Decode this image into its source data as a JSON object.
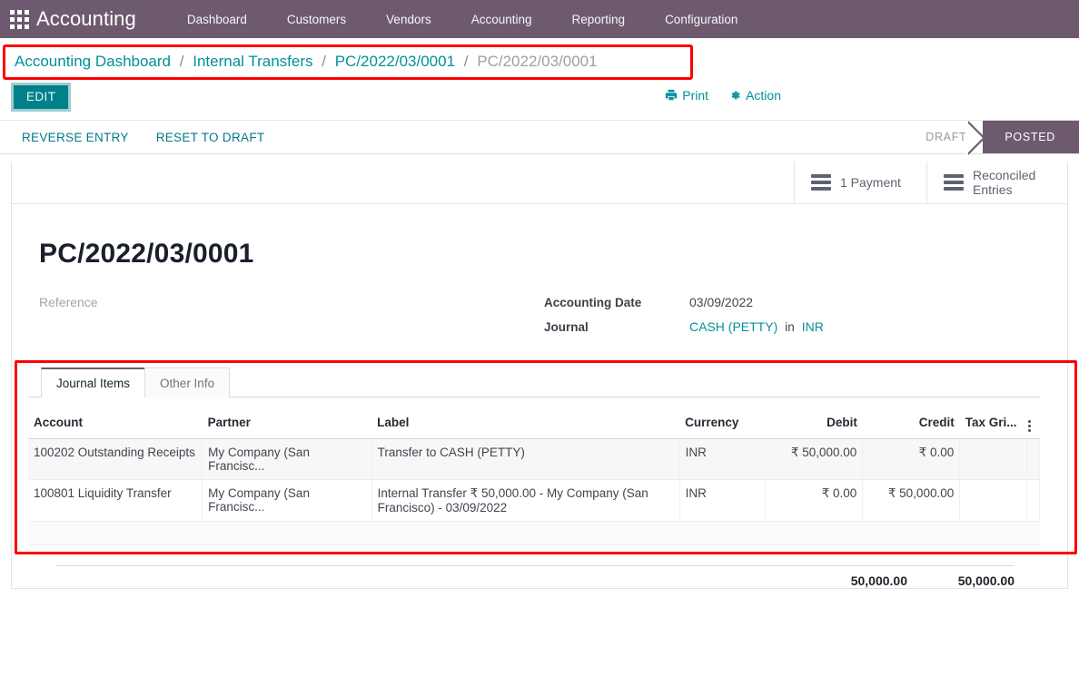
{
  "navbar": {
    "apps_icon": "apps-grid-icon",
    "brand": "Accounting",
    "menu": [
      {
        "label": "Dashboard"
      },
      {
        "label": "Customers"
      },
      {
        "label": "Vendors"
      },
      {
        "label": "Accounting"
      },
      {
        "label": "Reporting"
      },
      {
        "label": "Configuration"
      }
    ]
  },
  "breadcrumb": {
    "items": [
      {
        "label": "Accounting Dashboard",
        "type": "link"
      },
      {
        "label": "Internal Transfers",
        "type": "link"
      },
      {
        "label": "PC/2022/03/0001",
        "type": "link"
      },
      {
        "label": "PC/2022/03/0001",
        "type": "current"
      }
    ],
    "separator": "/"
  },
  "control_panel": {
    "edit_label": "EDIT",
    "print_label": "Print",
    "print_icon": "printer-icon",
    "action_label": "Action",
    "action_icon": "gear-icon"
  },
  "statusbar": {
    "buttons": [
      {
        "label": "REVERSE ENTRY"
      },
      {
        "label": "RESET TO DRAFT"
      }
    ],
    "states": [
      {
        "label": "DRAFT",
        "active": false
      },
      {
        "label": "POSTED",
        "active": true
      }
    ],
    "active_color": "#6d5a6e"
  },
  "smart_buttons": [
    {
      "label": "1 Payment",
      "icon": "bars-icon"
    },
    {
      "label": "Reconciled Entries",
      "icon": "bars-icon"
    }
  ],
  "record": {
    "title": "PC/2022/03/0001",
    "reference_placeholder": "Reference",
    "accounting_date_label": "Accounting Date",
    "accounting_date_value": "03/09/2022",
    "journal_label": "Journal",
    "journal_value": "CASH (PETTY)",
    "journal_in": "in",
    "journal_currency": "INR"
  },
  "notebook": {
    "tabs": [
      {
        "label": "Journal Items",
        "active": true
      },
      {
        "label": "Other Info",
        "active": false
      }
    ]
  },
  "journal_items": {
    "columns": [
      {
        "key": "account",
        "label": "Account",
        "align": "left"
      },
      {
        "key": "partner",
        "label": "Partner",
        "align": "left"
      },
      {
        "key": "label",
        "label": "Label",
        "align": "left"
      },
      {
        "key": "currency",
        "label": "Currency",
        "align": "left"
      },
      {
        "key": "debit",
        "label": "Debit",
        "align": "right"
      },
      {
        "key": "credit",
        "label": "Credit",
        "align": "right"
      },
      {
        "key": "tax_grids",
        "label": "Tax Gri...",
        "align": "left"
      }
    ],
    "options_icon": "vertical-dots-icon",
    "rows": [
      {
        "account": "100202 Outstanding Receipts",
        "partner": "My Company (San Francisc...",
        "label": "Transfer to CASH (PETTY)",
        "currency": "INR",
        "debit": "₹ 50,000.00",
        "credit": "₹ 0.00",
        "tax_grids": ""
      },
      {
        "account": "100801 Liquidity Transfer",
        "partner": "My Company (San Francisc...",
        "label": "Internal Transfer ₹ 50,000.00 - My Company (San Francisco) - 03/09/2022",
        "currency": "INR",
        "debit": "₹ 0.00",
        "credit": "₹ 50,000.00",
        "tax_grids": ""
      }
    ],
    "totals": {
      "debit": "50,000.00",
      "credit": "50,000.00"
    }
  },
  "highlights": {
    "color": "#ff0000",
    "regions": [
      "breadcrumb",
      "journal-items-notebook"
    ]
  },
  "theme": {
    "navbar_bg": "#6d5a6e",
    "accent_teal": "#00919a",
    "edit_button_bg": "#00808a"
  }
}
